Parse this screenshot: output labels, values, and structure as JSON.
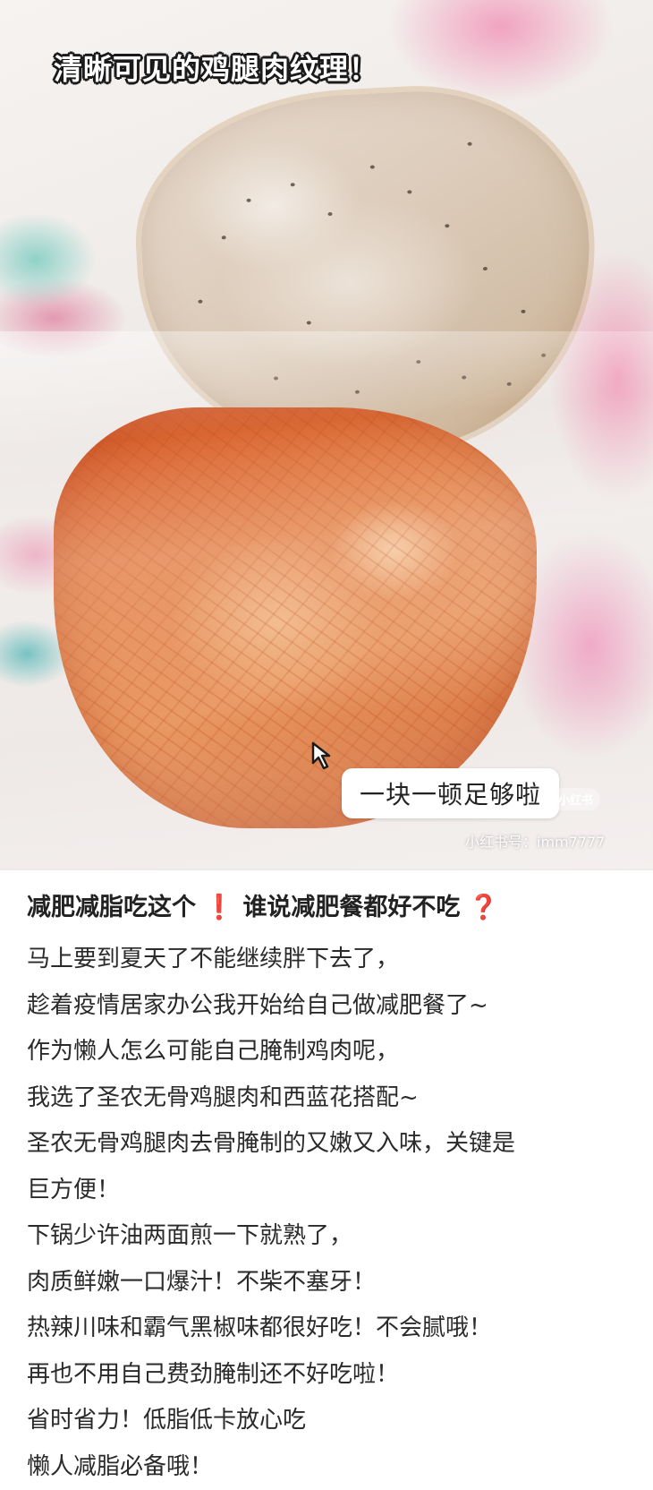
{
  "photo": {
    "caption": "清晰可见的鸡腿肉纹理！",
    "sticker_text": "一块一顿足够啦",
    "logo_text": "小红书",
    "watermark": "小红书号：imm7777"
  },
  "post": {
    "title_part1": "减肥减脂吃这个",
    "title_mark1": "❗",
    "title_part2": " 谁说减肥餐都好不吃",
    "title_mark2": "❓",
    "lines": [
      "马上要到夏天了不能继续胖下去了，",
      "趁着疫情居家办公我开始给自己做减肥餐了~",
      "作为懒人怎么可能自己腌制鸡肉呢，",
      "我选了圣农无骨鸡腿肉和西蓝花搭配~",
      "圣农无骨鸡腿肉去骨腌制的又嫩又入味，关键是",
      "巨方便！",
      "下锅少许油两面煎一下就熟了，",
      "肉质鲜嫩一口爆汁！不柴不塞牙！",
      "热辣川味和霸气黑椒味都很好吃！不会腻哦！",
      "再也不用自己费劲腌制还不好吃啦！",
      "省时省力！低脂低卡放心吃",
      "懒人减脂必备哦！"
    ]
  }
}
